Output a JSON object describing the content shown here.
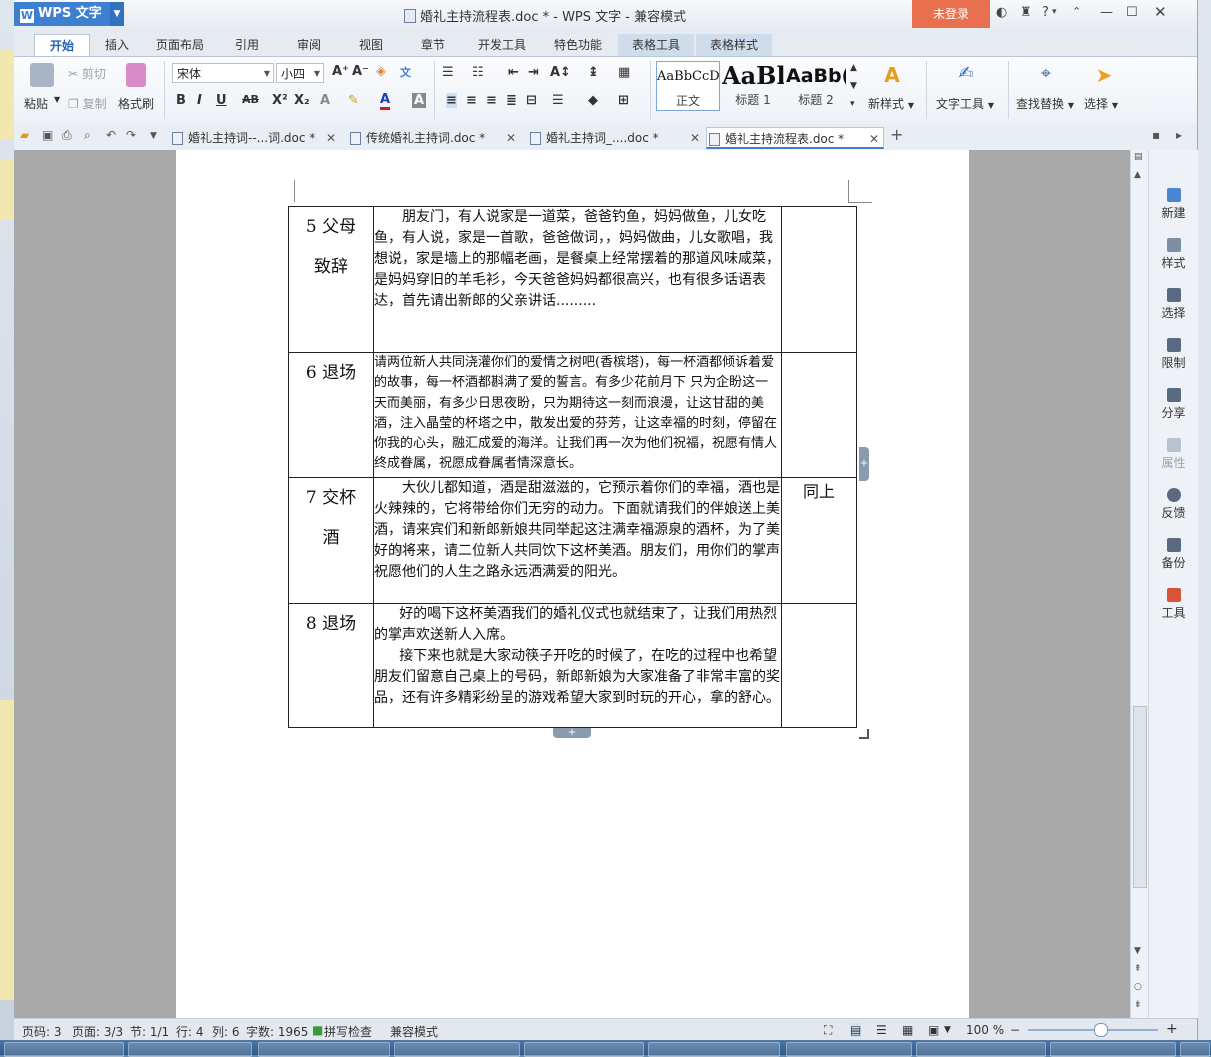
{
  "titlebar": {
    "app_name": "WPS 文字",
    "app_badge": "W",
    "document_title": "婚礼主持流程表.doc * - WPS 文字 - 兼容模式",
    "login_label": "未登录",
    "help_label": "?"
  },
  "ribbon_tabs": [
    {
      "label": "开始"
    },
    {
      "label": "插入"
    },
    {
      "label": "页面布局"
    },
    {
      "label": "引用"
    },
    {
      "label": "审阅"
    },
    {
      "label": "视图"
    },
    {
      "label": "章节"
    },
    {
      "label": "开发工具"
    },
    {
      "label": "特色功能"
    },
    {
      "label": "表格工具"
    },
    {
      "label": "表格样式"
    }
  ],
  "ribbon": {
    "paste": "粘贴",
    "cut": "剪切",
    "copy": "复制",
    "format_painter": "格式刷",
    "font_name": "宋体",
    "font_size": "小四",
    "styles": [
      {
        "preview": "AaBbCcD",
        "label": "正文"
      },
      {
        "preview": "AaBl",
        "label": "标题 1"
      },
      {
        "preview": "AaBb(",
        "label": "标题 2"
      }
    ],
    "new_style": "新样式",
    "text_tools": "文字工具",
    "find_replace": "查找替换",
    "select": "选择"
  },
  "doc_tabs": [
    {
      "label": "婚礼主持词--...词.doc *"
    },
    {
      "label": "传统婚礼主持词.doc *"
    },
    {
      "label": "婚礼主持词_....doc *"
    },
    {
      "label": "婚礼主持流程表.doc *"
    }
  ],
  "table_rows": [
    {
      "step_a": "5 父母",
      "step_b": "致辞",
      "content": "朋友门，有人说家是一道菜，爸爸钓鱼，妈妈做鱼，儿女吃鱼，有人说，家是一首歌，爸爸做词，，妈妈做曲，儿女歌唱，我想说，家是墙上的那幅老画，是餐桌上经常摆着的那道风味咸菜，是妈妈穿旧的羊毛衫，今天爸爸妈妈都很高兴，也有很多话语表达，首先请出新郎的父亲讲话.........",
      "note": ""
    },
    {
      "step_a": "6 退场",
      "step_b": "",
      "content": "请两位新人共同浇灌你们的爱情之树吧(香槟塔)，每一杯酒都倾诉着爱的故事，每一杯酒都斟满了爱的誓言。有多少花前月下  只为企盼这一天而美丽，有多少日思夜盼，只为期待这一刻而浪漫，让这甘甜的美酒，注入晶莹的杯塔之中，散发出爱的芬芳，让这幸福的时刻，停留在你我的心头，融汇成爱的海洋。让我们再一次为他们祝福，祝愿有情人终成眷属，祝愿成眷属者情深意长。",
      "note": ""
    },
    {
      "step_a": "7 交杯",
      "step_b": "酒",
      "content": "大伙儿都知道，酒是甜滋滋的，它预示着你们的幸福，酒也是火辣辣的，它将带给你们无穷的动力。下面就请我们的伴娘送上美酒，请来宾们和新郎新娘共同举起这注满幸福源泉的酒杯，为了美好的将来，请二位新人共同饮下这杯美酒。朋友们，用你们的掌声祝愿他们的人生之路永远洒满爱的阳光。",
      "note": "同上"
    },
    {
      "step_a": "8 退场",
      "step_b": "",
      "content": "好的喝下这杯美酒我们的婚礼仪式也就结束了，让我们用热烈的掌声欢送新人入席。",
      "content2": "接下来也就是大家动筷子开吃的时候了，在吃的过程中也希望朋友们留意自己桌上的号码，新郎新娘为大家准备了非常丰富的奖品，还有许多精彩纷呈的游戏希望大家到时玩的开心，拿的舒心。",
      "note": ""
    }
  ],
  "sidebar": [
    {
      "label": "新建"
    },
    {
      "label": "样式"
    },
    {
      "label": "选择"
    },
    {
      "label": "限制"
    },
    {
      "label": "分享"
    },
    {
      "label": "属性"
    },
    {
      "label": "反馈"
    },
    {
      "label": "备份"
    },
    {
      "label": "工具"
    }
  ],
  "statusbar": {
    "page_code": "页码: 3",
    "page": "页面: 3/3",
    "section": "节: 1/1",
    "row": "行: 4",
    "col": "列: 6",
    "word_count": "字数: 1965",
    "spell_check": "拼写检查",
    "compat_mode": "兼容模式",
    "zoom": "100 %",
    "zoom_level": 0.55
  },
  "colors": {
    "accent": "#3e7fd2",
    "login": "#e9704f"
  }
}
